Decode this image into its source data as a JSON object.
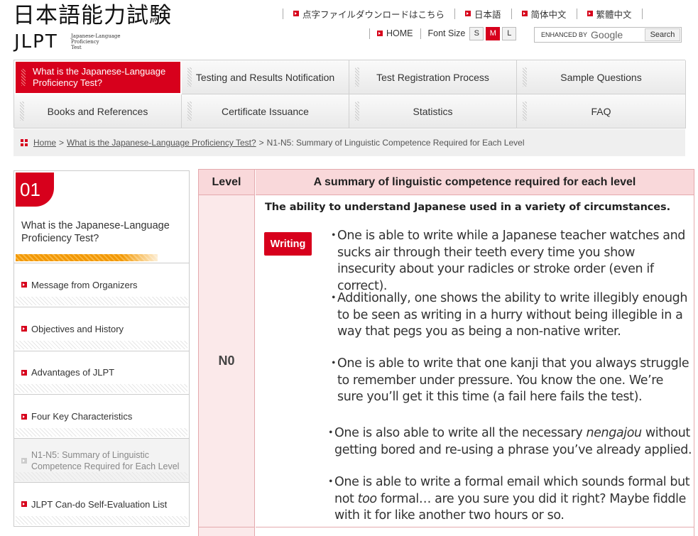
{
  "logo": {
    "title_jp": "日本語能力試験",
    "title_en": "JLPT",
    "subtitle_lines": [
      "Japanese-Language",
      "Proficiency",
      "Test"
    ]
  },
  "top_links": [
    "点字ファイルダウンロードはこちら",
    "日本語",
    "简体中文",
    "繁體中文"
  ],
  "utility": {
    "home": "HOME",
    "font_size_label": "Font Size",
    "font_sizes": [
      "S",
      "M",
      "L"
    ],
    "font_size_selected": "M",
    "search_enhanced": "ENHANCED BY",
    "search_brand": "Google",
    "search_button": "Search"
  },
  "nav": [
    "What is the Japanese-Language Proficiency Test?",
    "Testing and Results Notification",
    "Test Registration Process",
    "Sample Questions",
    "Books and References",
    "Certificate Issuance",
    "Statistics",
    "FAQ"
  ],
  "nav_active_index": 0,
  "breadcrumb": {
    "home": "Home",
    "parent": "What is the Japanese-Language Proficiency Test?",
    "current": "N1-N5: Summary of Linguistic Competence Required for Each Level",
    "separator": ">"
  },
  "sidebar": {
    "number": "01",
    "title": "What is the Japanese-Language Proficiency Test?",
    "items": [
      "Message from Organizers",
      "Objectives and History",
      "Advantages of JLPT",
      "Four Key Characteristics",
      "N1-N5: Summary of Linguistic Competence Required for Each Level",
      "JLPT Can-do Self-Evaluation List"
    ],
    "current_index": 4
  },
  "table": {
    "header_level": "Level",
    "header_summary": "A summary of linguistic competence required for each level",
    "level": "N0",
    "lead": "The ability to understand Japanese used in a variety of circumstances.",
    "skill_tag": "Writing",
    "bullet_marker": "・",
    "bullets": [
      {
        "a": "One is able to write while a Japanese teacher watches and sucks air through their teeth every time you show insecurity about your radicles or stroke order (even if correct).",
        "b": "",
        "c": ""
      },
      {
        "a": "Additionally, one shows the ability to write illegibly enough to be seen as writing in a hurry without being illegible in a way that pegs you as being a non-native writer.",
        "b": "",
        "c": ""
      },
      {
        "a": "One is able to write that one kanji that you always struggle to remember under pressure. You know the one. We’re sure you’ll get it this time (a fail here fails the test).",
        "b": "",
        "c": ""
      },
      {
        "a": "One is also able to write all the necessary ",
        "b": "nengajou",
        "c": " without getting bored and re-using a phrase you’ve already applied."
      },
      {
        "a": "One is able to write a formal email which sounds formal but not ",
        "b": "too",
        "c": " formal… are you sure you did it right? Maybe fiddle with it for like another two hours or so."
      }
    ]
  },
  "colors": {
    "brand_red": "#d7001c",
    "header_pink": "#f9d8da",
    "level_pink": "#fbe9ea",
    "accent_orange": "#f39800"
  }
}
